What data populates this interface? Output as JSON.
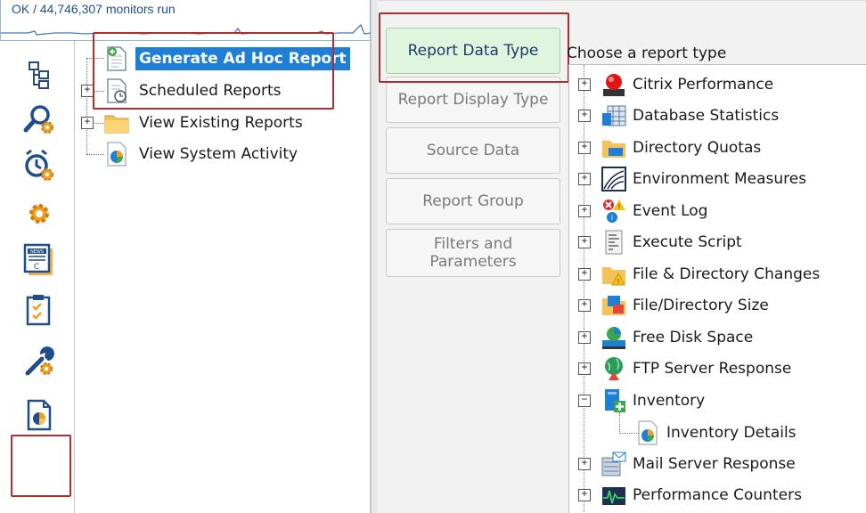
{
  "status": {
    "text": "OK / 44,746,307 monitors run"
  },
  "rail": {
    "items": [
      {
        "name": "tree-icon"
      },
      {
        "name": "search-gear-icon"
      },
      {
        "name": "alarm-gear-icon"
      },
      {
        "name": "gear-icon"
      },
      {
        "name": "news-icon"
      },
      {
        "name": "checklist-icon"
      },
      {
        "name": "wrench-gear-icon"
      },
      {
        "name": "report-icon",
        "active": true
      }
    ]
  },
  "tree": {
    "items": [
      {
        "label": "Generate Ad Hoc Report",
        "icon": "document-add-icon",
        "selected": true
      },
      {
        "label": "Scheduled Reports",
        "icon": "scheduled-doc-icon",
        "expander": "+"
      },
      {
        "label": "View Existing Reports",
        "icon": "folder-icon",
        "expander": "+"
      },
      {
        "label": "View System Activity",
        "icon": "pie-doc-icon"
      }
    ]
  },
  "tabs": [
    {
      "label": "Report Data Type",
      "active": true
    },
    {
      "label": "Report Display Type"
    },
    {
      "label": "Source Data"
    },
    {
      "label": "Report Group"
    },
    {
      "label": "Filters and Parameters"
    }
  ],
  "report_types": {
    "header": "Choose a report type",
    "items": [
      {
        "label": "Citrix Performance",
        "icon": "citrix-icon",
        "expander": "+"
      },
      {
        "label": "Database Statistics",
        "icon": "database-grid-icon",
        "expander": "+"
      },
      {
        "label": "Directory Quotas",
        "icon": "directory-quota-icon",
        "expander": "+"
      },
      {
        "label": "Environment Measures",
        "icon": "environment-icon",
        "expander": "+"
      },
      {
        "label": "Event Log",
        "icon": "event-log-icon",
        "expander": "+"
      },
      {
        "label": "Execute Script",
        "icon": "script-icon",
        "expander": "+"
      },
      {
        "label": "File & Directory Changes",
        "icon": "folder-warning-icon",
        "expander": "+"
      },
      {
        "label": "File/Directory Size",
        "icon": "file-size-icon",
        "expander": "+"
      },
      {
        "label": "Free Disk Space",
        "icon": "disk-icon",
        "expander": "+"
      },
      {
        "label": "FTP Server Response",
        "icon": "globe-icon",
        "expander": "+"
      },
      {
        "label": "Inventory",
        "icon": "inventory-icon",
        "expander": "−"
      },
      {
        "label": "Inventory Details",
        "icon": "pie-doc-icon",
        "child": true
      },
      {
        "label": "Mail Server Response",
        "icon": "mail-server-icon",
        "expander": "+"
      },
      {
        "label": "Performance Counters",
        "icon": "perf-counter-icon",
        "expander": "+"
      }
    ]
  }
}
